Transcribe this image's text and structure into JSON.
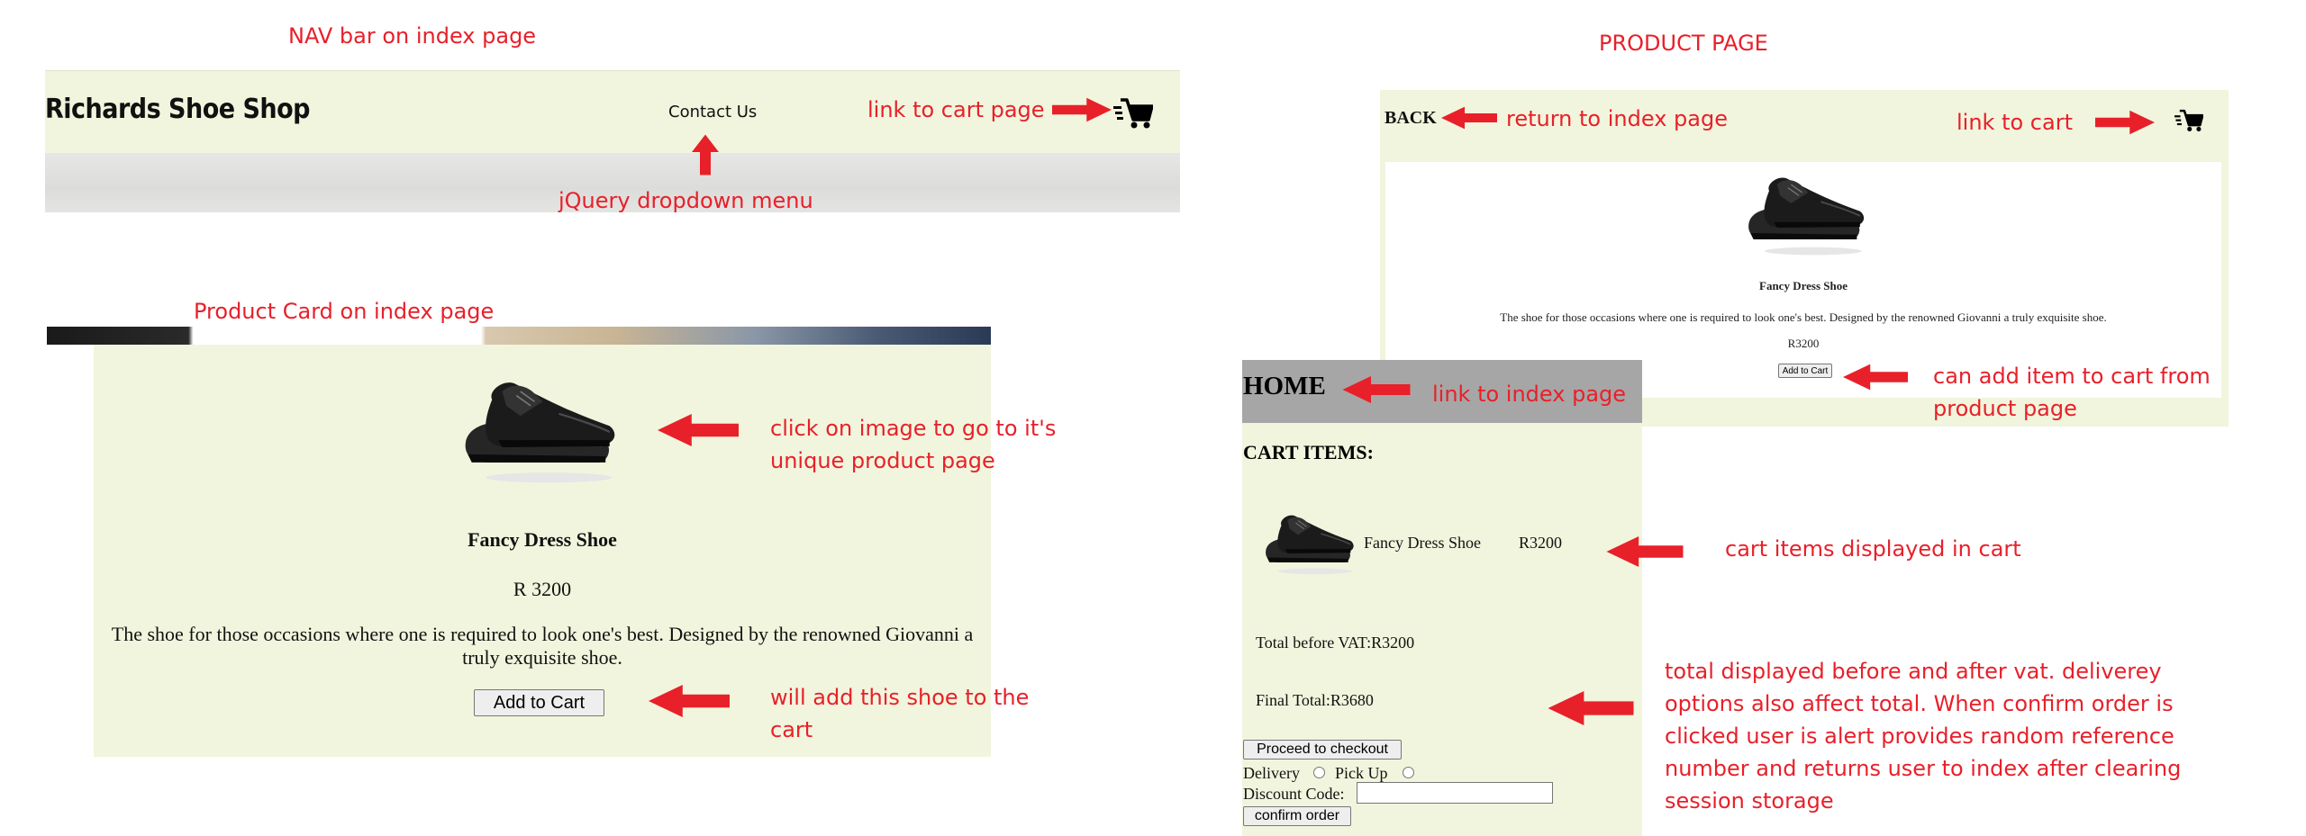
{
  "annotations": {
    "nav_title": "NAV bar  on index page",
    "nav_cart_link": "link to cart page",
    "nav_dropdown": "jQuery dropdown menu",
    "card_title": "Product Card on index page",
    "card_image": "click on image to go to it's unique product page",
    "card_add": "will add this shoe to the cart",
    "product_title": "PRODUCT PAGE",
    "product_back": "return to index page",
    "product_cart": "link to cart",
    "product_add": "can add item to cart from product page",
    "cart_home": "link to index page",
    "cart_items": "cart items displayed in cart",
    "cart_total": "total displayed before and after vat. deliverey options also affect total. When confirm order is clicked user is alert provides random reference number and returns user to index after clearing session storage"
  },
  "navbar": {
    "brand": "Richards Shoe Shop",
    "contact": "Contact Us",
    "cart_icon": "cart-icon"
  },
  "product_card": {
    "name": "Fancy Dress Shoe",
    "price": "R 3200",
    "description": "The shoe for those occasions where one is required to look one's best. Designed by the renowned Giovanni a truly exquisite shoe.",
    "add_button": "Add to Cart"
  },
  "product_page": {
    "back": "BACK",
    "cart_icon": "cart-icon",
    "name": "Fancy Dress Shoe",
    "description": "The shoe for those occasions where one is required to look one's best. Designed by the renowned Giovanni a truly exquisite shoe.",
    "price": "R3200",
    "add_button": "Add to Cart"
  },
  "cart_page": {
    "home": "HOME",
    "heading": "CART ITEMS:",
    "item_name": "Fancy Dress Shoe",
    "item_price": "R3200",
    "total_before": "Total before VAT:R3200",
    "final_total": "Final Total:R3680",
    "checkout_button": "Proceed to checkout",
    "delivery_label": "Delivery",
    "pickup_label": "Pick Up",
    "discount_label": "Discount Code:",
    "discount_value": "",
    "confirm_button": "confirm order"
  },
  "colors": {
    "annotation": "#e8202a",
    "panel_bg": "#f1f5dd",
    "home_bar": "#a6a6a6"
  }
}
